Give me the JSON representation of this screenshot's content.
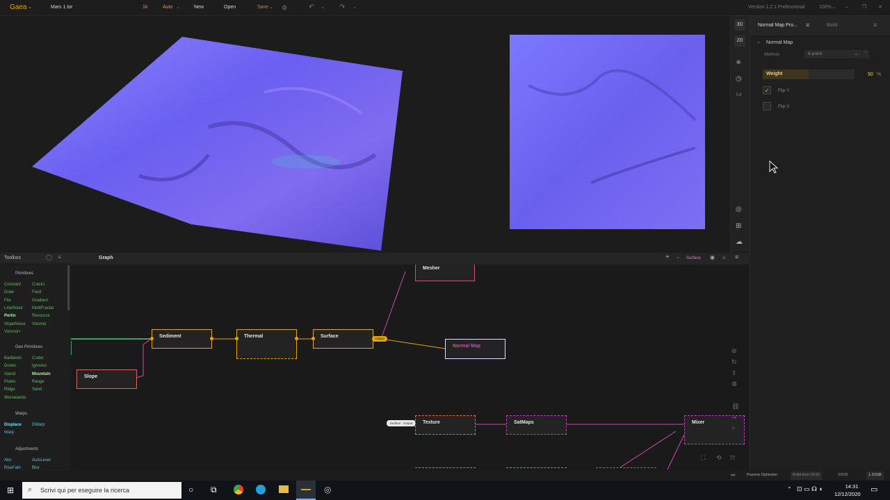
{
  "app": {
    "logo": "Gaea",
    "file": "Mars 1.tor",
    "resolution": "1k",
    "mode": "Auto",
    "new_label": "New",
    "open_label": "Open",
    "save_label": "Save",
    "version": "Version 1.2.1 Professional",
    "zoom": "100%"
  },
  "viewport_tools": [
    "3D",
    "2D",
    "Lv"
  ],
  "sidebar": {
    "tab_active": "Normal Map Pro...",
    "tab_build": "Build",
    "section": "Normal Map",
    "method_label": "Method",
    "method_value": "8-point",
    "weight_label": "Weight",
    "weight_value": "50",
    "weight_unit": "%",
    "weight_fraction": 0.5,
    "flip_y_label": "Flip Y",
    "flip_y_checked": true,
    "flip_x_label": "Flip X",
    "flip_x_checked": false
  },
  "toolbox": {
    "title": "Toolbox",
    "sections": [
      {
        "name": "Primitives"
      },
      {
        "name": "Geo Primitives"
      },
      {
        "name": "Warps"
      },
      {
        "name": "Adjustments"
      }
    ],
    "primitives": [
      "Constant",
      "Cracks",
      "Draw",
      "Fault",
      "File",
      "Gradient",
      "LineNoise",
      "MultiFractal",
      "Perlin",
      "Resource",
      "SlopeNoise",
      "Voronoi",
      "Voronoi+"
    ],
    "geo": [
      "Badlands",
      "Crater",
      "Dunes",
      "Igneous",
      "Island",
      "Mountain",
      "Plates",
      "Range",
      "Ridge",
      "Sand",
      "Worselands"
    ],
    "warps": [
      "Displace",
      "DWarp",
      "Warp"
    ],
    "adjust": [
      "Abs",
      "AutoLevel",
      "RiseFaln",
      "Blur"
    ]
  },
  "graph": {
    "tab": "Graph",
    "surface_label": "Surface",
    "nodes": {
      "mesher": "Mesher",
      "sediment": "Sediment",
      "thermal": "Thermal",
      "surface": "Surface",
      "normal_map": "Normal Map",
      "slope": "Slope",
      "texture": "Texture",
      "satmaps": "SatMaps",
      "mixer": "Mixer"
    },
    "output_tag": "Output",
    "surface_output_tag": "Surface : Output"
  },
  "status": {
    "optimizer": "Passive Optimizer",
    "build_time": "Build time 00:51",
    "mem1": "00MB",
    "mem2": "1.31GB"
  },
  "taskbar": {
    "search_placeholder": "Scrivi qui per eseguire la ricerca",
    "time": "14:31",
    "date": "12/12/2020"
  }
}
